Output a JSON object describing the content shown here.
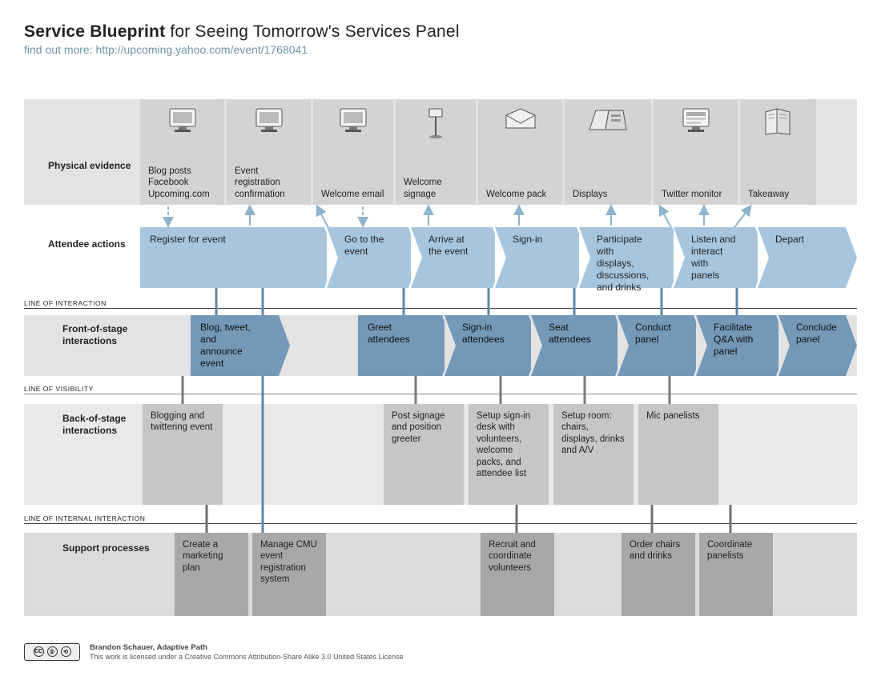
{
  "header": {
    "title_bold": "Service Blueprint",
    "title_rest": " for Seeing Tomorrow's Services Panel",
    "subtitle": "find out more: http://upcoming.yahoo.com/event/1768041"
  },
  "row_labels": {
    "evidence": "Physical evidence",
    "attendee": "Attendee actions",
    "front": "Front-of-stage interactions",
    "back": "Back-of-stage interactions",
    "support": "Support processes"
  },
  "line_labels": {
    "interaction": "LINE OF INTERACTION",
    "visibility": "LINE OF VISIBILITY",
    "internal": "LINE OF INTERNAL INTERACTION"
  },
  "evidence": [
    {
      "label": "Blog posts Facebook Upcoming.com",
      "icon": "monitor"
    },
    {
      "label": "Event registration confirmation",
      "icon": "monitor"
    },
    {
      "label": "Welcome email",
      "icon": "monitor"
    },
    {
      "label": "Welcome signage",
      "icon": "sign"
    },
    {
      "label": "Welcome pack",
      "icon": "envelope"
    },
    {
      "label": "Displays",
      "icon": "displays"
    },
    {
      "label": "Twitter monitor",
      "icon": "monitor2"
    },
    {
      "label": "Takeaway",
      "icon": "paper"
    }
  ],
  "attendee": [
    "Register for event",
    "Go to the event",
    "Arrive at the event",
    "Sign-in",
    "Participate with displays, discussions, and drinks",
    "Listen and interact with panels",
    "Depart"
  ],
  "front": [
    "Blog, tweet, and announce event",
    "Greet attendees",
    "Sign-in attendees",
    "Seat attendees",
    "Conduct panel",
    "Facilitate Q&A with panel",
    "Conclude panel"
  ],
  "back": [
    "Blogging and twittering event",
    "Post signage and position greeter",
    "Setup sign-in desk with volunteers, welcome packs, and attendee list",
    "Setup room: chairs, displays, drinks and A/V",
    "Mic panelists"
  ],
  "support": [
    "Create a marketing plan",
    "Manage CMU event registration system",
    "Recruit and coordinate volunteers",
    "Order chairs and drinks",
    "Coordinate panelists"
  ],
  "footer": {
    "credit": "Brandon Schauer, Adaptive Path",
    "license": "This work is licensed under a Creative Commons Attribution-Share Alike 3.0 United States License"
  }
}
